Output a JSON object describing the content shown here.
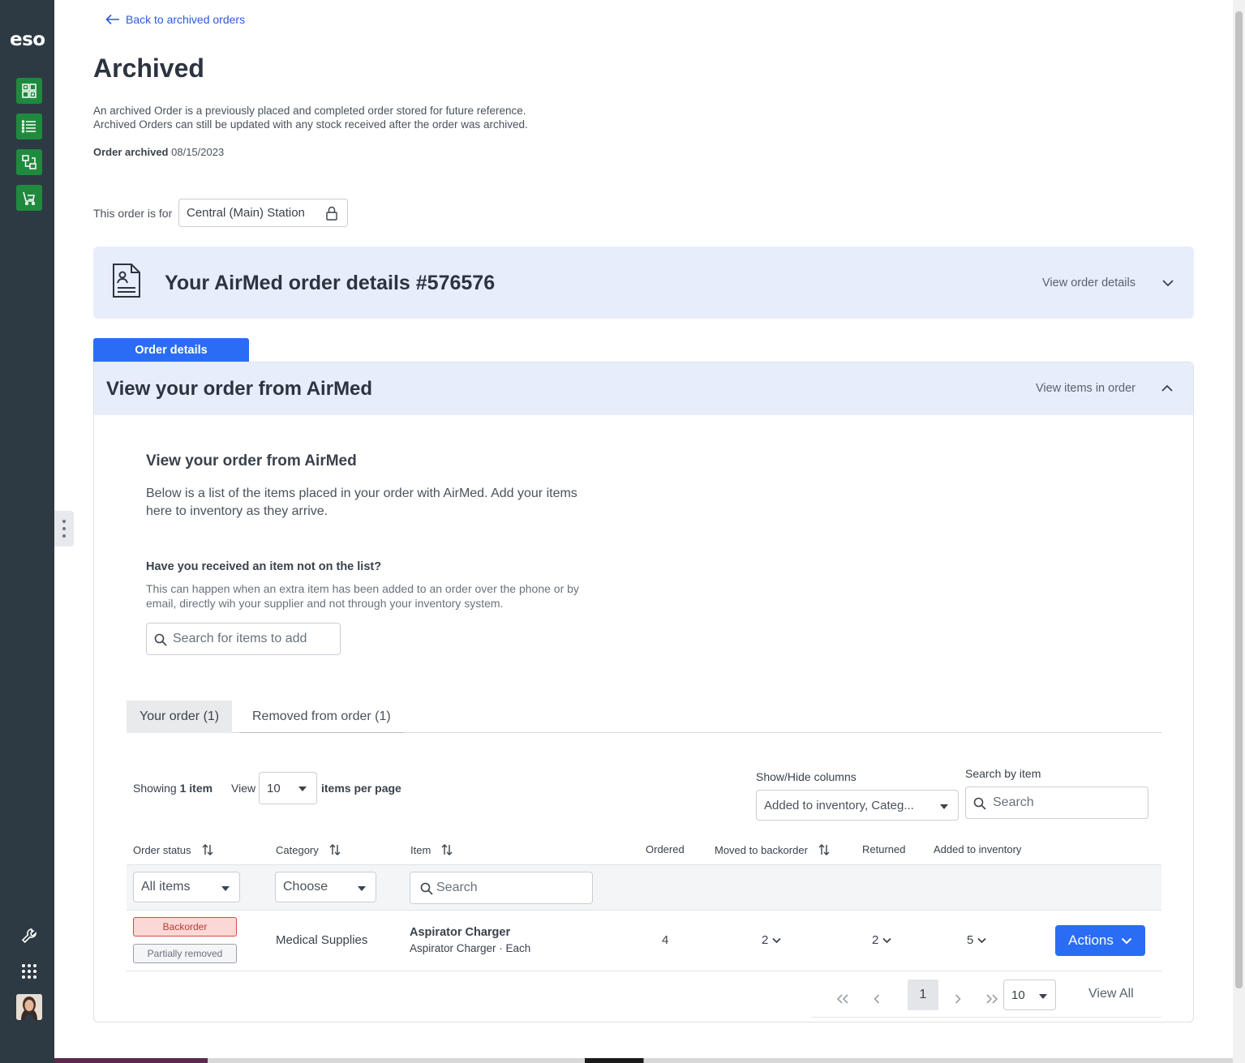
{
  "sidebar": {
    "logo": "eso",
    "nav_icons": [
      "inventory-grid-icon",
      "list-icon",
      "transfer-icon",
      "cart-icon"
    ],
    "bottom_icons": [
      "wrench-icon",
      "apps-grid-icon"
    ],
    "accent": "#1f8a3e",
    "background": "#2d3a44"
  },
  "header": {
    "back_link": "Back to archived orders",
    "title": "Archived",
    "description_line1": "An archived Order is a previously placed and completed order stored for future reference.",
    "description_line2": "Archived Orders can still be updated with any stock received after the order was archived.",
    "archived_label": "Order archived",
    "archived_date": "08/15/2023"
  },
  "order_for": {
    "label": "This order is for",
    "value": "Central (Main) Station"
  },
  "order_details_banner": {
    "title": "Your AirMed order details #576576",
    "toggle_label": "View order details"
  },
  "order_panel": {
    "tab_label": "Order details",
    "title": "View your order from AirMed",
    "toggle_label": "View items in order",
    "sub_title": "View your order from AirMed",
    "sub_desc": "Below is a list of the items placed in your order with AirMed. Add your items here to inventory as they arrive.",
    "question_title": "Have you received an item not on the list?",
    "question_desc": "This can happen when an extra item has been added to an order over the phone or by email, directly wih your supplier and not through your inventory system.",
    "add_search_placeholder": "Search for items to add"
  },
  "tabs": [
    {
      "label": "Your order (1)",
      "active": true
    },
    {
      "label": "Removed from order (1)",
      "active": false
    }
  ],
  "table_controls": {
    "showing_prefix": "Showing",
    "showing_count": "1 item",
    "view_label": "View",
    "per_page_value": "10",
    "per_page_suffix": "items per page",
    "show_hide_label": "Show/Hide columns",
    "show_hide_value": "Added to inventory, Categ...",
    "search_by_label": "Search by item",
    "search_placeholder": "Search"
  },
  "columns": {
    "order_status": "Order status",
    "category": "Category",
    "item": "Item",
    "ordered": "Ordered",
    "moved_to_backorder": "Moved to backorder",
    "returned": "Returned",
    "added_to_inventory": "Added to inventory"
  },
  "filters": {
    "status_value": "All items",
    "category_value": "Choose",
    "item_placeholder": "Search"
  },
  "rows": [
    {
      "status_badges": [
        "Backorder",
        "Partially removed"
      ],
      "category": "Medical Supplies",
      "item_name": "Aspirator Charger",
      "item_sub": "Aspirator Charger · Each",
      "ordered": "4",
      "moved_to_backorder": "2",
      "returned": "2",
      "added_to_inventory": "5",
      "actions_label": "Actions"
    }
  ],
  "pagination": {
    "current_page": "1",
    "per_page": "10",
    "view_all": "View All"
  },
  "colors": {
    "primary": "#2a6df4",
    "banner": "#e8edfb",
    "backorder": "#d64a42"
  }
}
